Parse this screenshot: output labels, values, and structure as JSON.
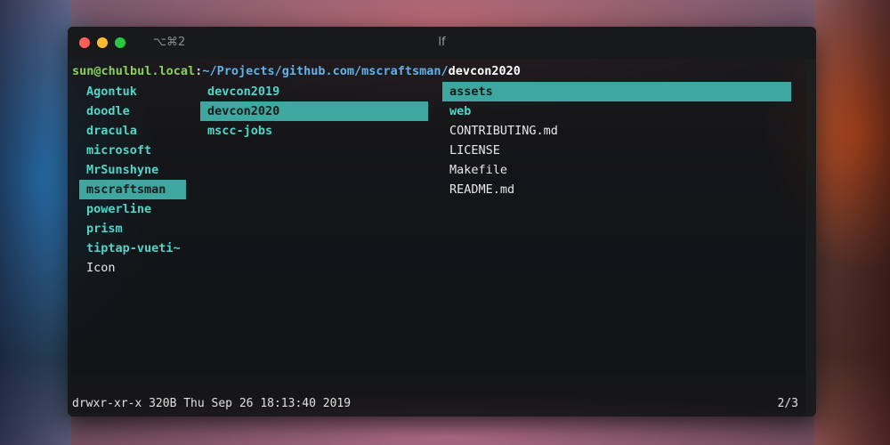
{
  "window": {
    "shortcut": "⌥⌘2",
    "title": "lf"
  },
  "path": {
    "user": "sun@chulbul.local",
    "sep": ":",
    "dir": "~/Projects/github.com/mscraftsman/",
    "current": "devcon2020"
  },
  "columns": {
    "parent": [
      {
        "label": "Agontuk",
        "type": "dir"
      },
      {
        "label": "doodle",
        "type": "dir"
      },
      {
        "label": "dracula",
        "type": "dir"
      },
      {
        "label": "microsoft",
        "type": "dir"
      },
      {
        "label": "MrSunshyne",
        "type": "dir"
      },
      {
        "label": "mscraftsman",
        "type": "dir"
      },
      {
        "label": "powerline",
        "type": "dir"
      },
      {
        "label": "prism",
        "type": "dir"
      },
      {
        "label": "tiptap-vueti~",
        "type": "dir"
      },
      {
        "label": "Icon",
        "type": "file"
      }
    ],
    "current": [
      {
        "label": "devcon2019",
        "type": "dir"
      },
      {
        "label": "devcon2020",
        "type": "dir"
      },
      {
        "label": "mscc-jobs",
        "type": "dir"
      }
    ],
    "preview": [
      {
        "label": "assets",
        "type": "dir"
      },
      {
        "label": "web",
        "type": "dir"
      },
      {
        "label": "CONTRIBUTING.md",
        "type": "file"
      },
      {
        "label": "LICENSE",
        "type": "file"
      },
      {
        "label": "Makefile",
        "type": "file"
      },
      {
        "label": "README.md",
        "type": "file"
      }
    ]
  },
  "status": {
    "info": "drwxr-xr-x 320B Thu Sep 26 18:13:40 2019",
    "position": "2/3"
  },
  "colors": {
    "selection": "#3ea8a0",
    "directory": "#4ed6c8",
    "user": "#8bd05e",
    "path": "#5fb3e8"
  }
}
